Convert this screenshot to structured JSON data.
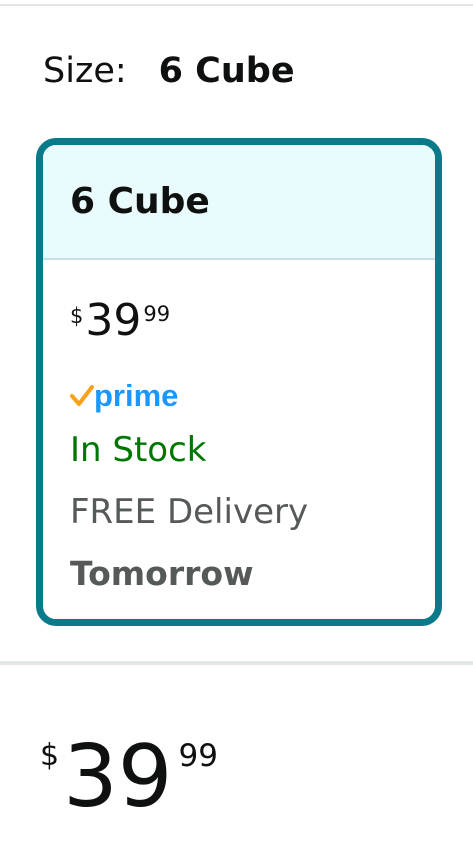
{
  "size_selector": {
    "label": "Size:",
    "selected_value": "6 Cube"
  },
  "option": {
    "title": "6 Cube",
    "price": {
      "currency": "$",
      "whole": "39",
      "fraction": "99"
    },
    "prime_label": "prime",
    "stock_status": "In Stock",
    "delivery_text": "FREE Delivery",
    "delivery_date": "Tomorrow"
  },
  "main_price": {
    "currency": "$",
    "whole": "39",
    "fraction": "99"
  },
  "colors": {
    "accent_border": "#087a8a",
    "header_bg": "#e9fbfd",
    "in_stock": "#007600",
    "prime_blue": "#1a98ff",
    "prime_check": "#f7a21c"
  }
}
